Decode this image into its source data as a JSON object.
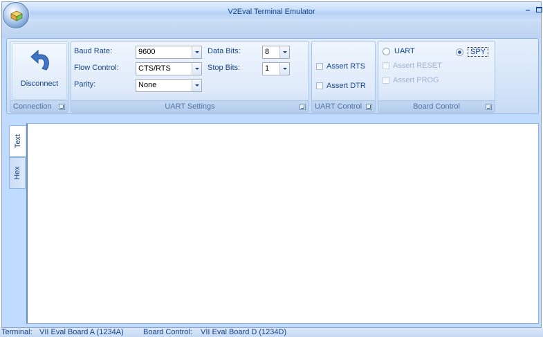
{
  "window": {
    "title": "V2Eval Terminal Emulator",
    "minimize_label": "–"
  },
  "ribbon": {
    "connection": {
      "group_label": "Connection",
      "disconnect_label": "Disconnect",
      "icon": "undo-arrow-icon"
    },
    "uart_settings": {
      "group_label": "UART Settings",
      "baud_rate_label": "Baud Rate:",
      "baud_rate_value": "9600",
      "flow_control_label": "Flow Control:",
      "flow_control_value": "CTS/RTS",
      "parity_label": "Parity:",
      "parity_value": "None",
      "data_bits_label": "Data Bits:",
      "data_bits_value": "8",
      "stop_bits_label": "Stop Bits:",
      "stop_bits_value": "1"
    },
    "uart_control": {
      "group_label": "UART Control",
      "assert_rts_label": "Assert RTS",
      "assert_rts_checked": false,
      "assert_dtr_label": "Assert DTR",
      "assert_dtr_checked": false
    },
    "board_control": {
      "group_label": "Board Control",
      "uart_label": "UART",
      "spy_label": "SPY",
      "selected_mode": "SPY",
      "assert_reset_label": "Assert RESET",
      "assert_prog_label": "Assert PROG"
    }
  },
  "view_tabs": [
    "Text",
    "Hex"
  ],
  "active_view_tab": "Text",
  "statusbar": {
    "terminal_label": "Terminal:",
    "terminal_value": "VII Eval Board A (1234A)",
    "board_control_label": "Board Control:",
    "board_control_value": "VII Eval Board D (1234D)"
  },
  "colors": {
    "accent": "#15428b",
    "ribbon_bg": "#bfdbff",
    "group_label": "#4f73a5"
  }
}
